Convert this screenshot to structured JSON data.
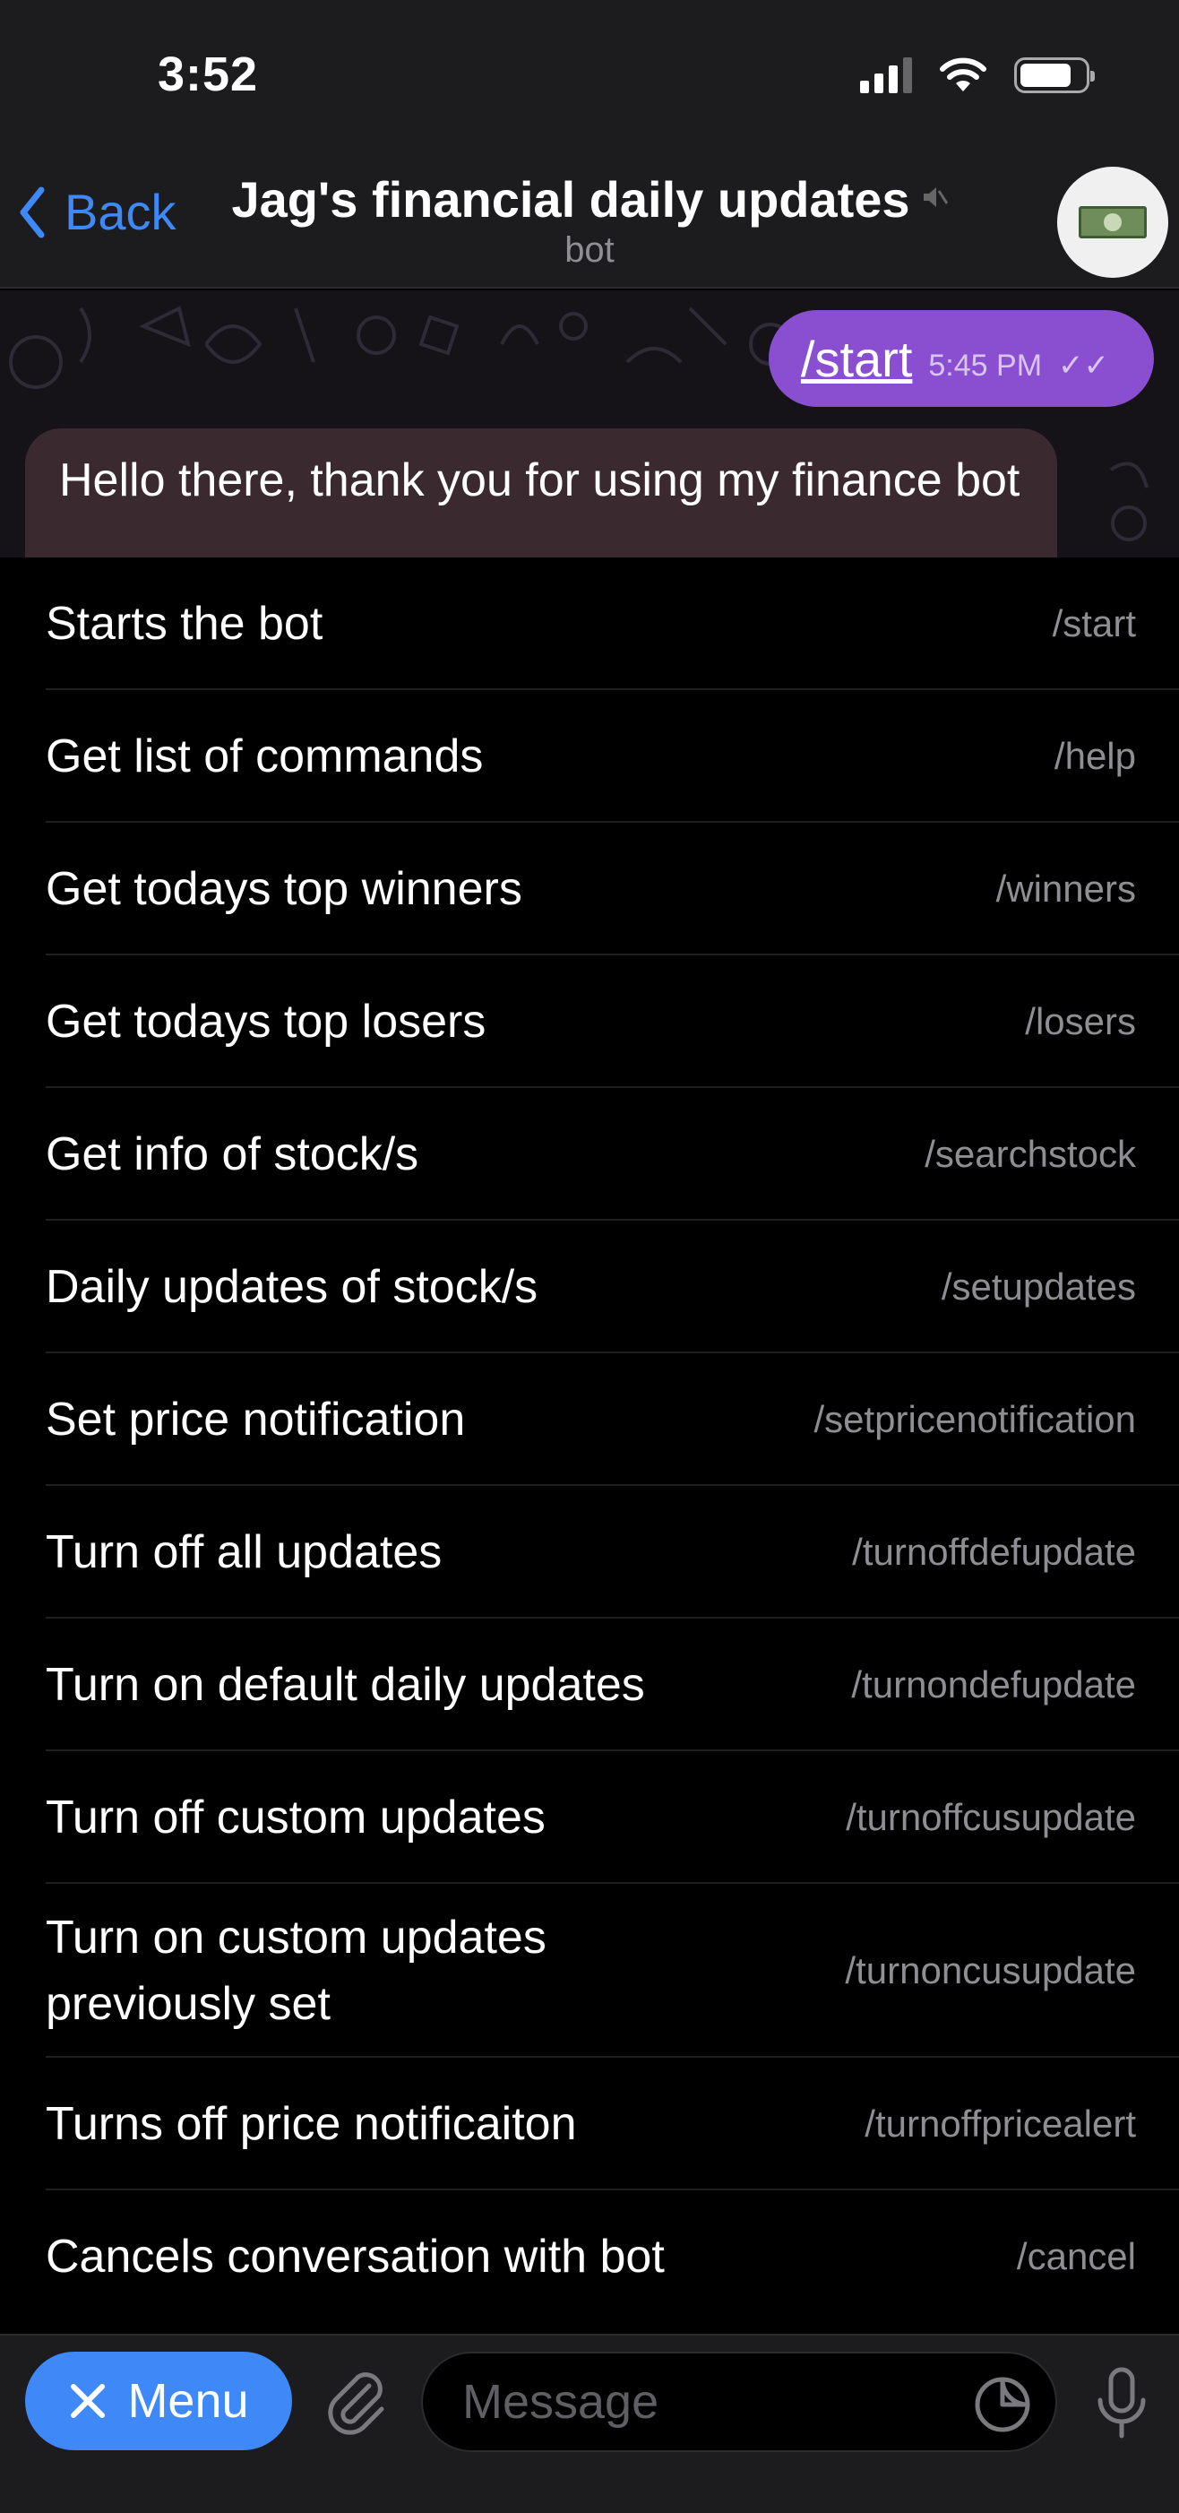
{
  "status_bar": {
    "time": "3:52",
    "icons": [
      "signal-icon",
      "wifi-icon",
      "battery-icon"
    ]
  },
  "header": {
    "back_label": "Back",
    "title": "Jag's financial daily updates",
    "subtitle": "bot",
    "muted_icon": "muted-speaker-icon",
    "avatar_icon": "dollar-bill-icon"
  },
  "chat": {
    "outgoing": {
      "text": "/start",
      "time": "5:45 PM",
      "ticks": "✓✓"
    },
    "incoming": {
      "text": "Hello there, thank you for using my finance bot"
    }
  },
  "commands": [
    {
      "description": "Starts the bot",
      "command": "/start"
    },
    {
      "description": "Get list of commands",
      "command": "/help"
    },
    {
      "description": "Get todays top winners",
      "command": "/winners"
    },
    {
      "description": "Get todays top losers",
      "command": "/losers"
    },
    {
      "description": "Get info of stock/s",
      "command": "/searchstock"
    },
    {
      "description": "Daily updates of stock/s",
      "command": "/setupdates"
    },
    {
      "description": "Set price notification",
      "command": "/setpricenotification"
    },
    {
      "description": "Turn off all updates",
      "command": "/turnoffdefupdate"
    },
    {
      "description": "Turn on default daily updates",
      "command": "/turnondefupdate"
    },
    {
      "description": "Turn off custom updates",
      "command": "/turnoffcusupdate"
    },
    {
      "description": "Turn on custom updates previously set",
      "command": "/turnoncusupdate"
    },
    {
      "description": "Turns off price notificaiton",
      "command": "/turnoffpricealert"
    },
    {
      "description": "Cancels conversation with bot",
      "command": "/cancel"
    }
  ],
  "bottom_bar": {
    "menu_label": "Menu",
    "message_placeholder": "Message"
  },
  "colors": {
    "accent": "#3e88f7",
    "outgoing_bubble": "#8a4fd0",
    "background": "#000000"
  }
}
